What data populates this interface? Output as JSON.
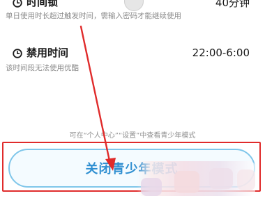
{
  "settings": {
    "time_lock": {
      "icon": "clock-icon",
      "title": "时间锁",
      "value": "40分钟",
      "description": "单日使用时长超过触发时间，需输入密码才能继续使用"
    },
    "curfew": {
      "icon": "clock-icon",
      "title": "禁用时间",
      "value": "22:00-6:00",
      "description": "该时间段无法使用优酷"
    }
  },
  "hint": "可在“个人中心”“设置”中查看青少年模式",
  "button": {
    "label": "关闭青少年模式"
  },
  "colors": {
    "button_border": "#7fc6ea",
    "button_text": "#2f8fd1",
    "highlight": "#e02b2b",
    "arrow": "#e02b2b"
  }
}
